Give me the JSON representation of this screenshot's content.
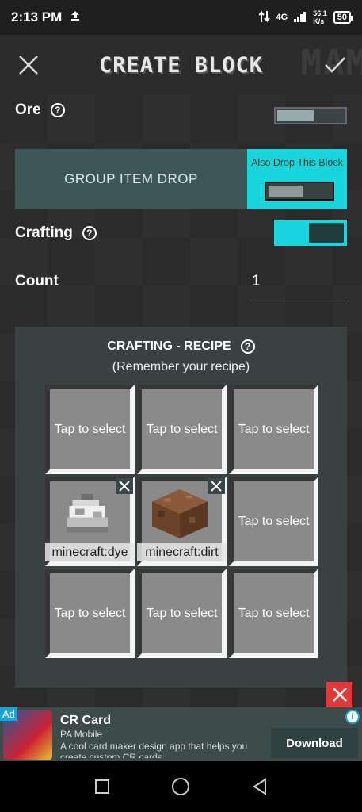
{
  "status_bar": {
    "time": "2:13 PM",
    "network": "4G",
    "speed": "56.1\nK/s",
    "battery": "50"
  },
  "header": {
    "title": "CREATE BLOCK",
    "watermark": "MAM"
  },
  "rows": {
    "ore_label": "Ore",
    "ore_help": "?",
    "group_item_drop": "GROUP ITEM DROP",
    "also_drop": "Also Drop This Block",
    "crafting_label": "Crafting",
    "crafting_help": "?",
    "crafting_enabled": true,
    "count_label": "Count",
    "count_value": "1"
  },
  "recipe": {
    "title": "CRAFTING - RECIPE",
    "help": "?",
    "subtitle": "(Remember your recipe)",
    "slots": [
      {
        "text": "Tap to select"
      },
      {
        "text": "Tap to select"
      },
      {
        "text": "Tap to select"
      },
      {
        "item": "minecraft:dye",
        "icon": "dye-icon"
      },
      {
        "item": "minecraft:dirt",
        "icon": "dirt-block-icon"
      },
      {
        "text": "Tap to select"
      },
      {
        "text": "Tap to select"
      },
      {
        "text": "Tap to select"
      },
      {
        "text": "Tap to select"
      }
    ]
  },
  "ad": {
    "badge": "Ad",
    "title": "CR Card",
    "publisher": "PA Mobile",
    "description": "A cool card maker design app that helps you create custom CR cards",
    "cta": "Download"
  },
  "colors": {
    "accent": "#19d5de",
    "panel": "#3a4142",
    "close": "#e0393a"
  }
}
